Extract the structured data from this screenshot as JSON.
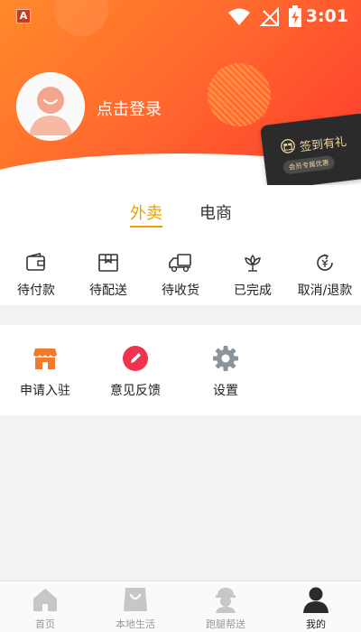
{
  "status_bar": {
    "time": "3:01",
    "app_icon": "A"
  },
  "profile": {
    "login_text": "点击登录"
  },
  "signin_card": {
    "title": "签到有礼",
    "subtitle": "会员专属优惠"
  },
  "tabs": [
    {
      "label": "外卖",
      "active": true
    },
    {
      "label": "电商",
      "active": false
    }
  ],
  "orders": [
    {
      "label": "待付款",
      "icon": "wallet-icon"
    },
    {
      "label": "待配送",
      "icon": "package-icon"
    },
    {
      "label": "待收货",
      "icon": "truck-icon"
    },
    {
      "label": "已完成",
      "icon": "flower-icon"
    },
    {
      "label": "取消/退款",
      "icon": "refund-icon"
    }
  ],
  "tools": [
    {
      "label": "申请入驻",
      "icon": "store-icon"
    },
    {
      "label": "意见反馈",
      "icon": "pencil-icon"
    },
    {
      "label": "设置",
      "icon": "gear-icon"
    }
  ],
  "bottom_nav": [
    {
      "label": "首页",
      "icon": "home-icon",
      "active": false
    },
    {
      "label": "本地生活",
      "icon": "shopping-bag-icon",
      "active": false
    },
    {
      "label": "跑腿帮送",
      "icon": "courier-icon",
      "active": false
    },
    {
      "label": "我的",
      "icon": "user-icon",
      "active": true
    }
  ],
  "colors": {
    "accent": "#e8a300",
    "header_start": "#ff8a2a",
    "header_end": "#ff3a2f",
    "store": "#f07a2d",
    "feedback": "#f0334f"
  }
}
